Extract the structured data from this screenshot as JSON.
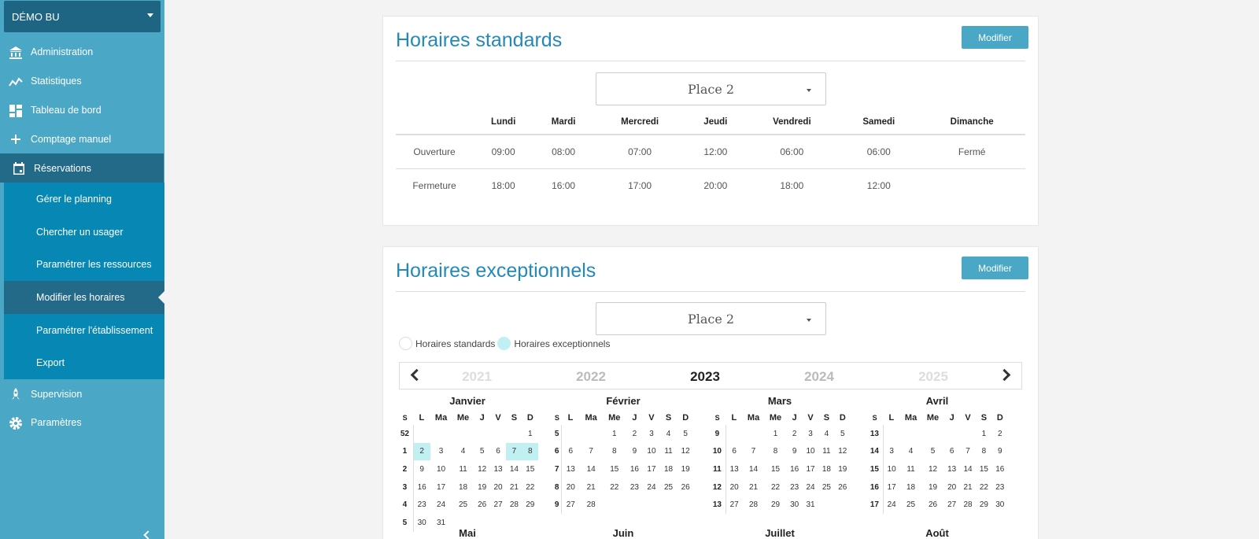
{
  "sidebar": {
    "bu": "DÉMO BU",
    "items": [
      {
        "label": "Administration",
        "icon": "bank-icon"
      },
      {
        "label": "Statistiques",
        "icon": "chart-icon"
      },
      {
        "label": "Tableau de bord",
        "icon": "dashboard-icon"
      },
      {
        "label": "Comptage manuel",
        "icon": "plus-icon"
      },
      {
        "label": "Réservations",
        "icon": "calendar-icon"
      }
    ],
    "sub": [
      {
        "label": "Gérer le planning"
      },
      {
        "label": "Chercher un usager"
      },
      {
        "label": "Paramétrer les ressources"
      },
      {
        "label": "Modifier les horaires"
      },
      {
        "label": "Paramétrer l'établissement"
      },
      {
        "label": "Export"
      }
    ],
    "bottom": [
      {
        "label": "Supervision",
        "icon": "rocket-icon"
      },
      {
        "label": "Paramètres",
        "icon": "gear-icon"
      }
    ]
  },
  "standard": {
    "title": "Horaires standards",
    "modify": "Modifier",
    "place": "Place 2",
    "days": [
      "Lundi",
      "Mardi",
      "Mercredi",
      "Jeudi",
      "Vendredi",
      "Samedi",
      "Dimanche"
    ],
    "rows": [
      {
        "label": "Ouverture",
        "values": [
          "09:00",
          "08:00",
          "07:00",
          "12:00",
          "06:00",
          "06:00",
          "Fermé"
        ]
      },
      {
        "label": "Fermeture",
        "values": [
          "18:00",
          "16:00",
          "17:00",
          "20:00",
          "18:00",
          "12:00",
          ""
        ]
      }
    ]
  },
  "exceptional": {
    "title": "Horaires exceptionnels",
    "modify": "Modifier",
    "place": "Place 2",
    "legend_standard": "Horaires standards",
    "legend_exceptional": "Horaires exceptionnels",
    "years": [
      "2021",
      "2022",
      "2023",
      "2024",
      "2025"
    ],
    "current_year": "2023",
    "weekday_headers": [
      "S",
      "L",
      "Ma",
      "Me",
      "J",
      "V",
      "S",
      "D"
    ],
    "months": [
      {
        "name": "Janvier",
        "weeks": [
          {
            "wk": "52",
            "days": [
              "",
              "",
              "",
              "",
              "",
              "",
              "1"
            ]
          },
          {
            "wk": "1",
            "days": [
              "2",
              "3",
              "4",
              "5",
              "6",
              "7",
              "8"
            ]
          },
          {
            "wk": "2",
            "days": [
              "9",
              "10",
              "11",
              "12",
              "13",
              "14",
              "15"
            ]
          },
          {
            "wk": "3",
            "days": [
              "16",
              "17",
              "18",
              "19",
              "20",
              "21",
              "22"
            ]
          },
          {
            "wk": "4",
            "days": [
              "23",
              "24",
              "25",
              "26",
              "27",
              "28",
              "29"
            ]
          },
          {
            "wk": "5",
            "days": [
              "30",
              "31",
              "",
              "",
              "",
              "",
              ""
            ]
          }
        ],
        "highlight": [
          "2",
          "7",
          "8"
        ]
      },
      {
        "name": "Février",
        "weeks": [
          {
            "wk": "5",
            "days": [
              "",
              "",
              "1",
              "2",
              "3",
              "4",
              "5"
            ]
          },
          {
            "wk": "6",
            "days": [
              "6",
              "7",
              "8",
              "9",
              "10",
              "11",
              "12"
            ]
          },
          {
            "wk": "7",
            "days": [
              "13",
              "14",
              "15",
              "16",
              "17",
              "18",
              "19"
            ]
          },
          {
            "wk": "8",
            "days": [
              "20",
              "21",
              "22",
              "23",
              "24",
              "25",
              "26"
            ]
          },
          {
            "wk": "9",
            "days": [
              "27",
              "28",
              "",
              "",
              "",
              "",
              ""
            ]
          }
        ],
        "highlight": []
      },
      {
        "name": "Mars",
        "weeks": [
          {
            "wk": "9",
            "days": [
              "",
              "",
              "1",
              "2",
              "3",
              "4",
              "5"
            ]
          },
          {
            "wk": "10",
            "days": [
              "6",
              "7",
              "8",
              "9",
              "10",
              "11",
              "12"
            ]
          },
          {
            "wk": "11",
            "days": [
              "13",
              "14",
              "15",
              "16",
              "17",
              "18",
              "19"
            ]
          },
          {
            "wk": "12",
            "days": [
              "20",
              "21",
              "22",
              "23",
              "24",
              "25",
              "26"
            ]
          },
          {
            "wk": "13",
            "days": [
              "27",
              "28",
              "29",
              "30",
              "31",
              "",
              ""
            ]
          }
        ],
        "highlight": []
      },
      {
        "name": "Avril",
        "weeks": [
          {
            "wk": "13",
            "days": [
              "",
              "",
              "",
              "",
              "",
              "1",
              "2"
            ]
          },
          {
            "wk": "14",
            "days": [
              "3",
              "4",
              "5",
              "6",
              "7",
              "8",
              "9"
            ]
          },
          {
            "wk": "15",
            "days": [
              "10",
              "11",
              "12",
              "13",
              "14",
              "15",
              "16"
            ]
          },
          {
            "wk": "16",
            "days": [
              "17",
              "18",
              "19",
              "20",
              "21",
              "22",
              "23"
            ]
          },
          {
            "wk": "17",
            "days": [
              "24",
              "25",
              "26",
              "27",
              "28",
              "29",
              "30"
            ]
          }
        ],
        "highlight": []
      }
    ],
    "next_months": [
      "Mai",
      "Juin",
      "Juillet",
      "Août"
    ]
  },
  "colors": {
    "accent": "#2389b8",
    "sidebar": "#4aa7c5",
    "sidebar_dark": "#236a88",
    "highlight": "#c0f0f2"
  }
}
